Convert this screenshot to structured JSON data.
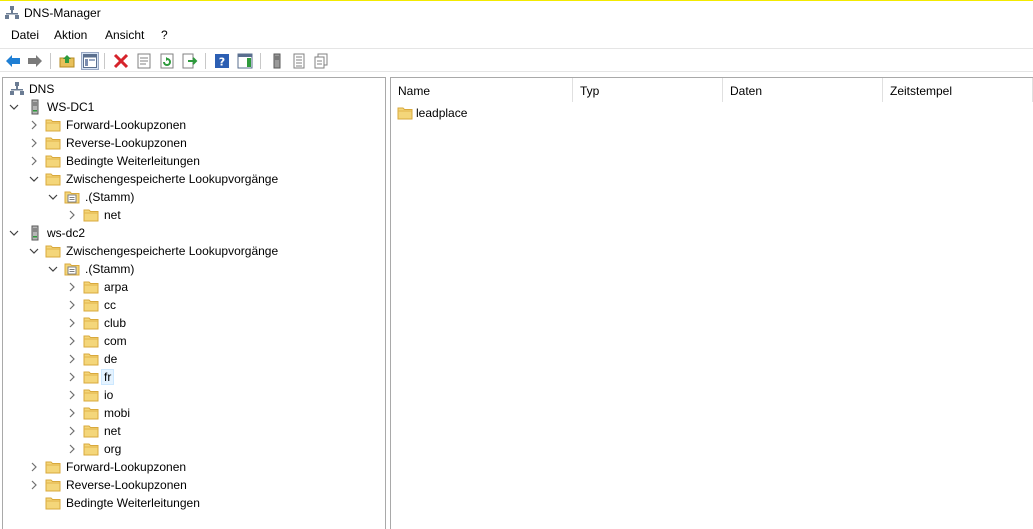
{
  "window": {
    "title": "DNS-Manager"
  },
  "menu": {
    "items": [
      "Datei",
      "Aktion",
      "Ansicht",
      "?"
    ]
  },
  "tree": {
    "root": "DNS",
    "server1": {
      "name": "WS-DC1",
      "forward": "Forward-Lookupzonen",
      "reverse": "Reverse-Lookupzonen",
      "conditional": "Bedingte Weiterleitungen",
      "cache": "Zwischengespeicherte Lookupvorgänge",
      "stamm": ".(Stamm)",
      "children": [
        "net"
      ]
    },
    "server2": {
      "name": "ws-dc2",
      "cache": "Zwischengespeicherte Lookupvorgänge",
      "stamm": ".(Stamm)",
      "children": [
        "arpa",
        "cc",
        "club",
        "com",
        "de",
        "fr",
        "io",
        "mobi",
        "net",
        "org"
      ],
      "forward": "Forward-Lookupzonen",
      "reverse": "Reverse-Lookupzonen",
      "conditional": "Bedingte Weiterleitungen"
    }
  },
  "list": {
    "columns": [
      "Name",
      "Typ",
      "Daten",
      "Zeitstempel"
    ],
    "rows": [
      {
        "name": "leadplace"
      }
    ]
  },
  "colors": {
    "folder": "#f4d67a",
    "folder_edge": "#d9a93c",
    "selection": "#e5f3ff",
    "title_accent": "#f3ea00"
  }
}
